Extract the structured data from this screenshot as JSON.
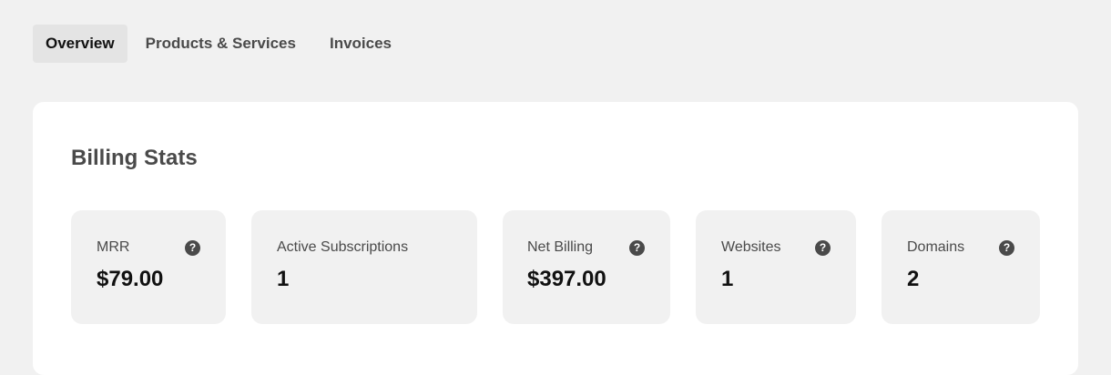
{
  "tabs": [
    {
      "label": "Overview",
      "active": true
    },
    {
      "label": "Products & Services",
      "active": false
    },
    {
      "label": "Invoices",
      "active": false
    }
  ],
  "billing": {
    "title": "Billing Stats",
    "stats": [
      {
        "label": "MRR",
        "value": "$79.00",
        "help": true,
        "help_icon": "question-circle-icon"
      },
      {
        "label": "Active Subscriptions",
        "value": "1",
        "help": false
      },
      {
        "label": "Net Billing",
        "value": "$397.00",
        "help": true,
        "help_icon": "question-circle-icon"
      },
      {
        "label": "Websites",
        "value": "1",
        "help": true,
        "help_icon": "question-circle-icon"
      },
      {
        "label": "Domains",
        "value": "2",
        "help": true,
        "help_icon": "question-circle-icon"
      }
    ]
  },
  "colors": {
    "page_background": "#f1f1f1",
    "card_background": "#ffffff",
    "stat_background": "#f1f1f1",
    "active_tab_background": "#e4e4e4",
    "muted_text": "#4a4a4a",
    "strong_text": "#111111"
  }
}
